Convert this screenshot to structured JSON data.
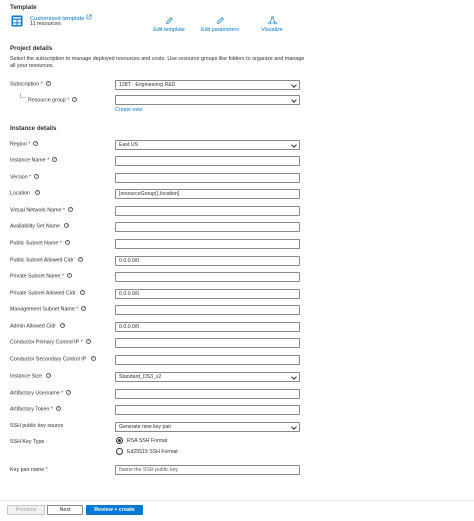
{
  "template": {
    "section_title": "Template",
    "link_label": "Customized template",
    "subtitle": "11 resources",
    "actions": {
      "edit_template": "Edit template",
      "edit_parameters": "Edit parameters",
      "visualize": "Visualize"
    }
  },
  "project": {
    "section_title": "Project details",
    "description": "Select the subscription to manage deployed resources and costs. Use resource groups like folders to organize and manage all your resources.",
    "subscription_label": "Subscription",
    "subscription_value": "128T - Engineering R&D",
    "resource_group_label": "Resource group",
    "resource_group_value": "",
    "create_new": "Create new"
  },
  "instance": {
    "section_title": "Instance details",
    "fields": [
      {
        "label": "Region",
        "required": "*",
        "value": "East US"
      },
      {
        "label": "Instance Name",
        "required": "*",
        "value": ""
      },
      {
        "label": "Version",
        "required": "*",
        "value": ""
      },
      {
        "label": "Location",
        "required": "",
        "value": "[resourceGroup().location]"
      },
      {
        "label": "Virtual Network Name",
        "required": "*",
        "value": ""
      },
      {
        "label": "Availability Set Name",
        "required": "",
        "value": ""
      },
      {
        "label": "Public Subnet Name",
        "required": "*",
        "value": ""
      },
      {
        "label": "Public Subnet Allowed Cidr",
        "required": "",
        "value": "0.0.0.0/0"
      },
      {
        "label": "Private Subnet Name",
        "required": "*",
        "value": ""
      },
      {
        "label": "Private Subnet Allowed Cidr",
        "required": "",
        "value": "0.0.0.0/0"
      },
      {
        "label": "Management Subnet Name",
        "required": "*",
        "value": ""
      },
      {
        "label": "Admin Allowed Cidr",
        "required": "",
        "value": "0.0.0.0/0"
      },
      {
        "label": "Conductor Primary Control IP",
        "required": "*",
        "value": ""
      },
      {
        "label": "Conductor Secondary Control IP",
        "required": "",
        "value": ""
      },
      {
        "label": "Instance Size",
        "required": "",
        "value": "Standard_DS3_v2"
      },
      {
        "label": "Artifactory Username",
        "required": "*",
        "value": ""
      },
      {
        "label": "Artifactory Token",
        "required": "*",
        "value": ""
      },
      {
        "label": "SSH public key source",
        "required": "",
        "value": "Generate new key pair"
      }
    ],
    "ssh_key_type_label": "SSH Key Type",
    "ssh_options": [
      "RSA SSH Format",
      "Ed25519 SSH Format"
    ],
    "ssh_selected": "RSA SSH Format",
    "key_pair_label": "Key pair name",
    "key_pair_required": "*",
    "key_pair_placeholder": "Name the SSH public key"
  },
  "footer": {
    "previous": "Previous",
    "next": "Next",
    "review": "Review + create"
  },
  "colors": {
    "accent": "#0078d4",
    "required": "#a4262c",
    "border": "#8a8886"
  }
}
